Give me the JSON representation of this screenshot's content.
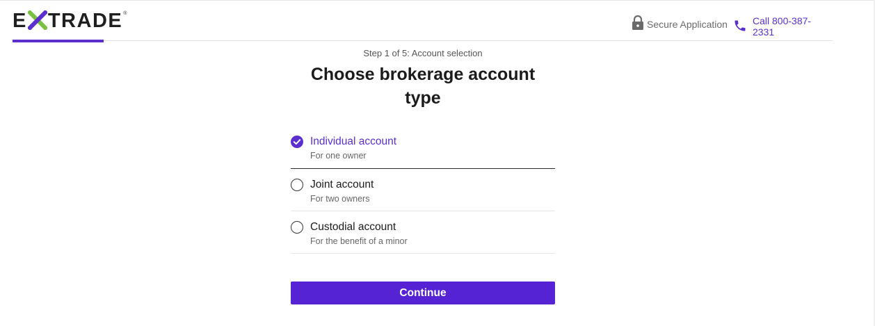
{
  "header": {
    "logo": {
      "left": "E",
      "right": "TRADE",
      "mark": "®"
    },
    "secure_label": "Secure Application",
    "phone_label": "Call 800-387-2331"
  },
  "main": {
    "step": "Step 1 of 5: Account selection",
    "title_line1": "Choose brokerage account",
    "title_line2": "type",
    "options": [
      {
        "label": "Individual account",
        "sub": "For one owner",
        "selected": true
      },
      {
        "label": "Joint account",
        "sub": "For two owners",
        "selected": false
      },
      {
        "label": "Custodial account",
        "sub": "For the benefit of a minor",
        "selected": false
      }
    ],
    "continue_label": "Continue"
  },
  "colors": {
    "accent": "#5a2fce",
    "button": "#5522d4",
    "logo_x_green": "#7ac142"
  },
  "icons": [
    "lock-icon",
    "phone-icon",
    "check-icon",
    "logo-x-mark"
  ]
}
